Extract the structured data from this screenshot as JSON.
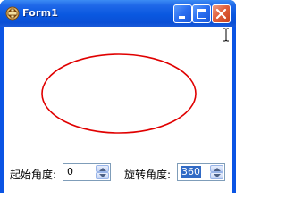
{
  "window": {
    "title": "Form1",
    "icon": "app-icon",
    "controls": {
      "minimize": "minimize-icon",
      "maximize": "maximize-icon",
      "close": "close-icon"
    }
  },
  "canvas": {
    "shape": "ellipse",
    "stroke_color": "#e00000"
  },
  "controls": {
    "start_angle": {
      "label": "起始角度:",
      "value": "0"
    },
    "rotation_angle": {
      "label": "旋转角度:",
      "value": "360"
    }
  },
  "colors": {
    "titlebar": "#0a58e0",
    "close_button": "#e0603c",
    "selection": "#316ac5"
  }
}
